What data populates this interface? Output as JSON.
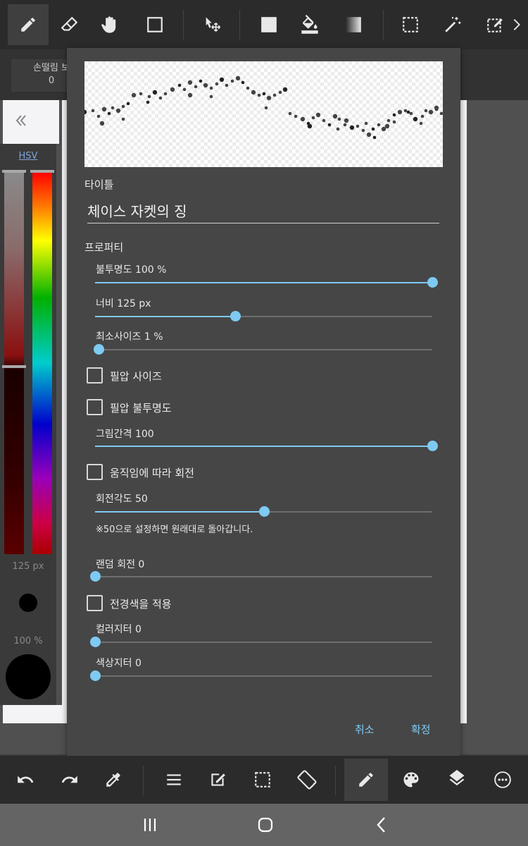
{
  "sub_tab": {
    "label": "손떨림 보",
    "value": "0"
  },
  "color_panel": {
    "mode_label": "HSV",
    "brush_size": "125 px",
    "opacity": "100 %"
  },
  "dialog": {
    "title_label": "타이틀",
    "title_value": "체이스 자켓의 징",
    "properties_label": "프로퍼티",
    "opacity_label": "불투명도  100  %",
    "opacity_value": 1.0,
    "width_label": "너비  125  px",
    "width_value": 0.416,
    "min_size_label": "최소사이즈  1  %",
    "min_size_value": 0.01,
    "pressure_size_label": "필압 사이즈",
    "pressure_size_checked": false,
    "pressure_opacity_label": "필압 불투명도",
    "pressure_opacity_checked": false,
    "spacing_label": "그림간격  100",
    "spacing_value": 1.0,
    "rotate_with_motion_label": "움직임에 따라 회전",
    "rotate_with_motion_checked": false,
    "rotation_angle_label": "회전각도  50",
    "rotation_angle_value": 0.5,
    "rotation_note": "※50으로 설정하면 원래대로 돌아갑니다.",
    "random_rotation_label": "랜덤 회전  0",
    "random_rotation_value": 0,
    "apply_fg_color_label": "전경색을 적용",
    "apply_fg_color_checked": false,
    "color_jitter_label": "컬러지터  0",
    "color_jitter_value": 0,
    "hue_jitter_label": "색상지터  0",
    "hue_jitter_value": 0,
    "cancel_label": "취소",
    "confirm_label": "확정"
  },
  "colors": {
    "accent": "#7ecaf2",
    "dialog_bg": "#464646",
    "toolbar_bg": "#2b2b2b"
  },
  "top_toolbar_icons": [
    "pen-icon",
    "eraser-icon",
    "hand-icon",
    "square-icon",
    "move-icon",
    "fill-square-icon",
    "bucket-icon",
    "gradient-icon",
    "selection-icon",
    "magic-wand-icon",
    "select-pen-icon",
    "chevron-right-icon"
  ],
  "bottom_toolbar_icons": [
    "undo-icon",
    "redo-icon",
    "eyedropper-icon",
    "menu-icon",
    "edit-icon",
    "selection-icon",
    "rotate-screen-icon",
    "brush-icon",
    "palette-icon",
    "layers-icon",
    "more-icon"
  ],
  "nav_icons": [
    "recent-apps-icon",
    "home-icon",
    "back-icon"
  ]
}
